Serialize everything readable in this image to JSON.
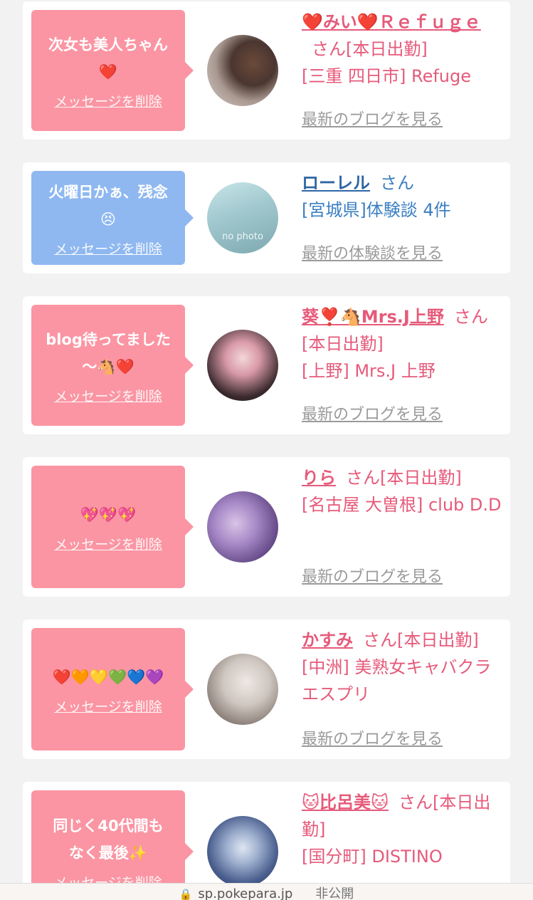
{
  "delete_label": "メッセージを削除",
  "items": [
    {
      "message": "次女も美人ちゃん\n❤️",
      "name": "❤️みい❤️Ｒｅｆｕｇｅ",
      "san": "さん[本日出勤]",
      "shop": "[三重 四日市] Refuge",
      "link": "最新のブログを見る"
    },
    {
      "message": "火曜日かぁ、残念\n😣",
      "name": "ローレル",
      "san": "さん",
      "shop": "[宮城県]体験談 4件",
      "link": "最新の体験談を見る",
      "avatar_text": "no photo"
    },
    {
      "message": "blog待ってました\n〜🐴❤️",
      "name": "葵❣️🐴Mrs.J上野",
      "san": "さん[本日出勤]",
      "shop": "[上野] Mrs.J 上野",
      "link": "最新のブログを見る"
    },
    {
      "message": "💖💖💖",
      "name": "りら",
      "san": "さん[本日出勤]",
      "shop": "[名古屋 大曽根] club D.D",
      "link": "最新のブログを見る"
    },
    {
      "message": "❤️🧡💛💚💙💜",
      "name": "かすみ",
      "san": "さん[本日出勤]",
      "shop": "[中洲] 美熟女キャバクラ エスプリ",
      "link": "最新のブログを見る"
    },
    {
      "message": "同じく40代間も\nなく最後✨",
      "name": "🐱比呂美🐱",
      "san": "さん[本日出勤]",
      "shop": "[国分町] DISTINO",
      "link": ""
    }
  ],
  "browser_bar": {
    "url": "sp.pokepara.jp",
    "mode": "非公開"
  },
  "colors": {
    "pink_bubble": "#fb95a3",
    "blue_bubble": "#8fb8f1",
    "pink_text": "#e65a7a",
    "blue_text": "#3a7fc2"
  }
}
